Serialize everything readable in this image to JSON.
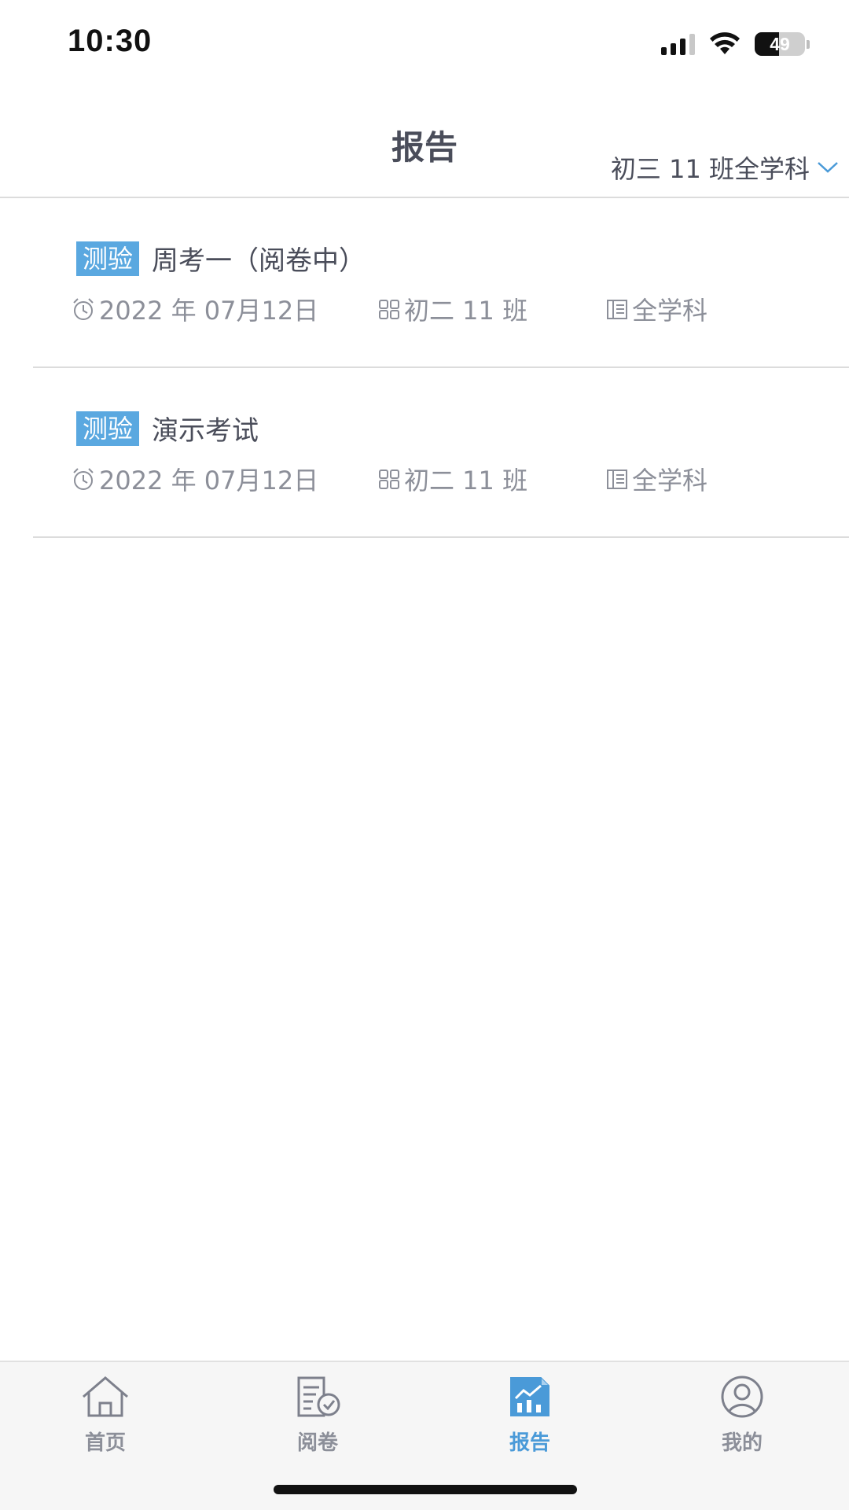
{
  "status_bar": {
    "time": "10:30",
    "battery": "49",
    "battery_level": 0.49,
    "signal_bars": 3,
    "icons": [
      "cellular-signal-icon",
      "wifi-icon",
      "battery-icon"
    ]
  },
  "header": {
    "title": "报告",
    "filter_label": "初三 11 班全学科",
    "filter_icon": "chevron-down-icon"
  },
  "reports": [
    {
      "tag": "测验",
      "title": "周考一（阅卷中）",
      "date": "2022 年 07月12日",
      "class": "初二 11 班",
      "subject": "全学科"
    },
    {
      "tag": "测验",
      "title": "演示考试",
      "date": "2022 年 07月12日",
      "class": "初二 11 班",
      "subject": "全学科"
    }
  ],
  "tabs": [
    {
      "label": "首页",
      "icon": "home-icon",
      "active": false
    },
    {
      "label": "阅卷",
      "icon": "paper-check-icon",
      "active": false
    },
    {
      "label": "报告",
      "icon": "report-chart-icon",
      "active": true
    },
    {
      "label": "我的",
      "icon": "user-profile-icon",
      "active": false
    }
  ],
  "colors": {
    "accent": "#4a9ad8",
    "tag_bg": "#5aa8e0",
    "text_primary": "#4a4d5a",
    "text_secondary": "#8c8f99",
    "divider": "#dcdcdc",
    "tabbar_bg": "#f6f6f6"
  }
}
